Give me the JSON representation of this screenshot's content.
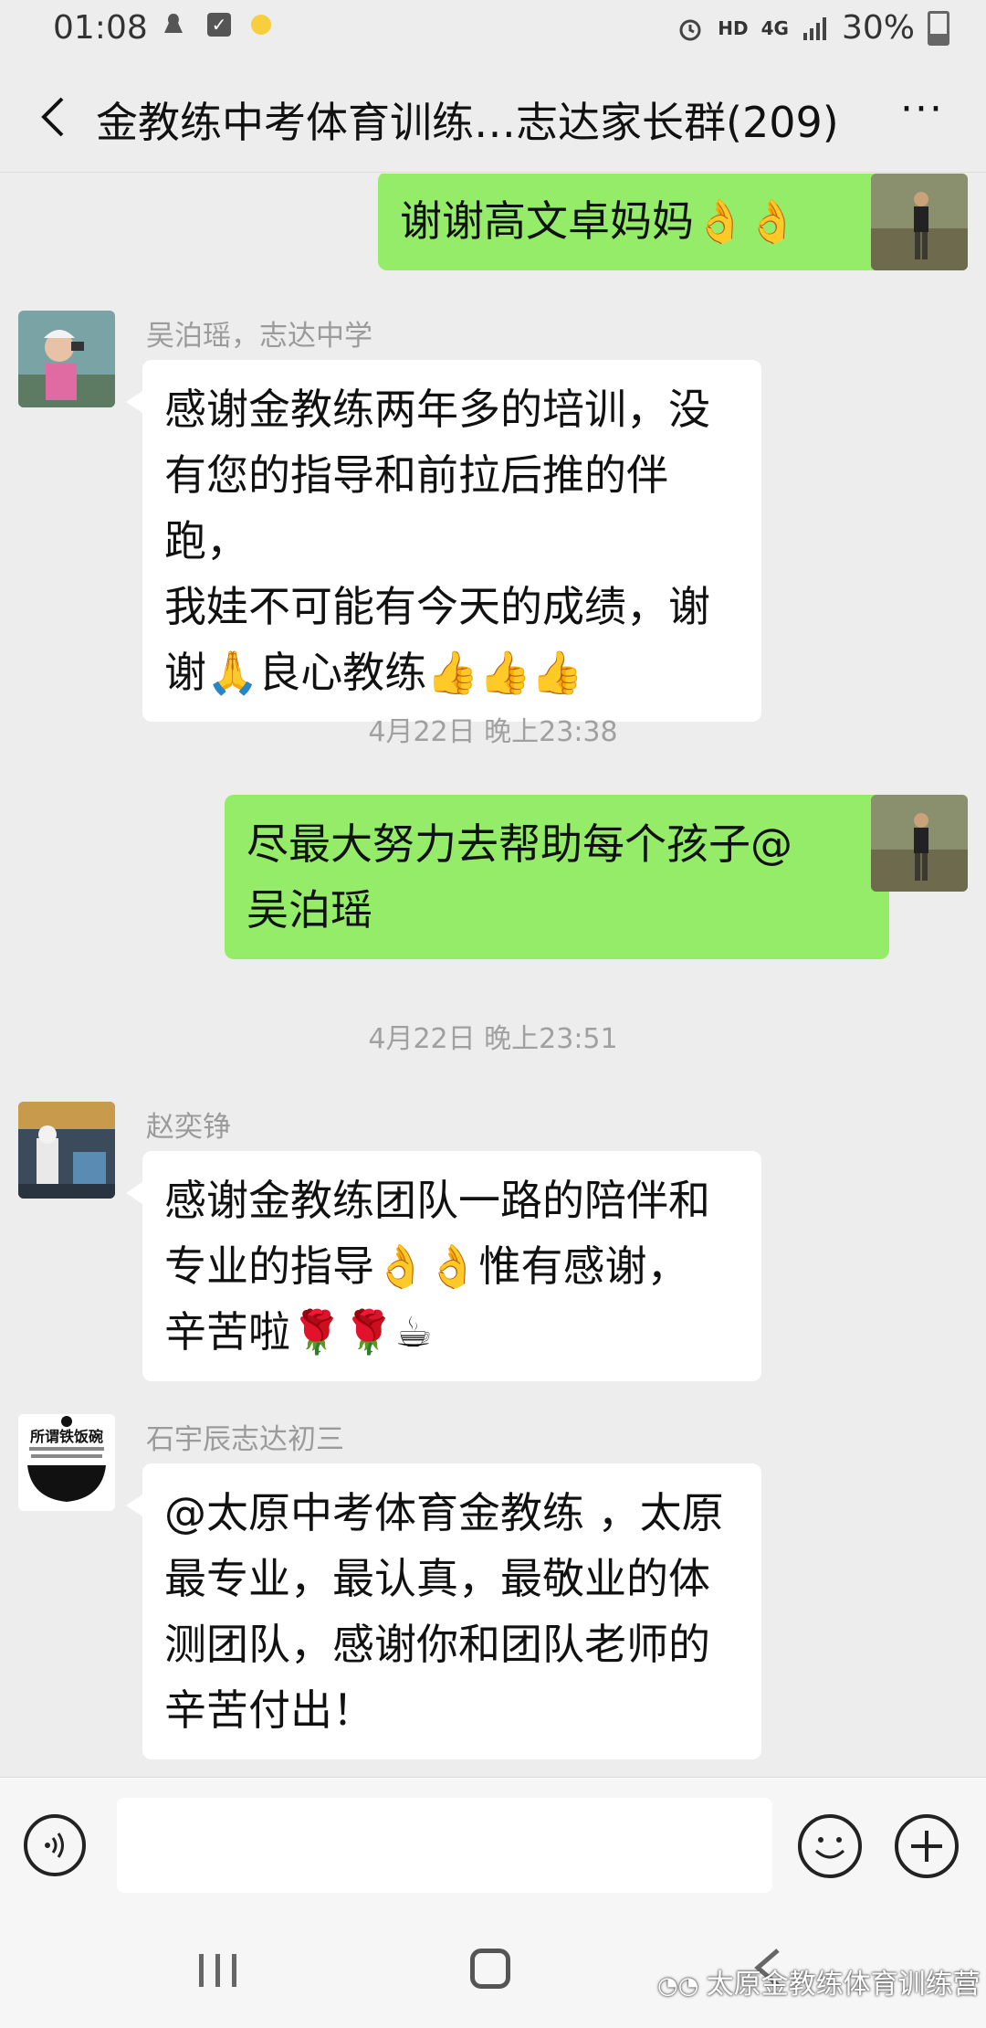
{
  "status_bar": {
    "time": "01:08",
    "hd": "HD",
    "network": "4G",
    "battery": "30%"
  },
  "header": {
    "title": "金教练中考体育训练…志达家长群(209)",
    "more": "···"
  },
  "messages": [
    {
      "side": "self",
      "text": "谢谢高文卓妈妈👌👌"
    },
    {
      "side": "other",
      "sender": "吴泊瑶，志达中学",
      "lines": [
        "感谢金教练两年多的培训，没",
        "有您的指导和前拉后推的伴跑，",
        "我娃不可能有今天的成绩，谢",
        "谢🙏良心教练👍👍👍"
      ]
    },
    {
      "timestamp": "4月22日 晚上23:38"
    },
    {
      "side": "self",
      "lines": [
        "尽最大努力去帮助每个孩子@",
        "吴泊瑶"
      ]
    },
    {
      "timestamp": "4月22日 晚上23:51"
    },
    {
      "side": "other",
      "sender": "赵奕铮",
      "lines": [
        "感谢金教练团队一路的陪伴和",
        "专业的指导👌👌惟有感谢，",
        "辛苦啦🌹🌹☕"
      ]
    },
    {
      "side": "other",
      "sender": "石宇辰志达初三",
      "lines": [
        "@太原中考体育金教练 ，太原",
        "最专业，最认真，最敬业的体",
        "测团队，感谢你和团队老师的",
        "辛苦付出！"
      ]
    }
  ],
  "avatar_text": {
    "shiyuchen_logo": "所谓铁饭碗"
  },
  "input": {
    "placeholder": ""
  },
  "watermark": "太原金教练体育训练营"
}
